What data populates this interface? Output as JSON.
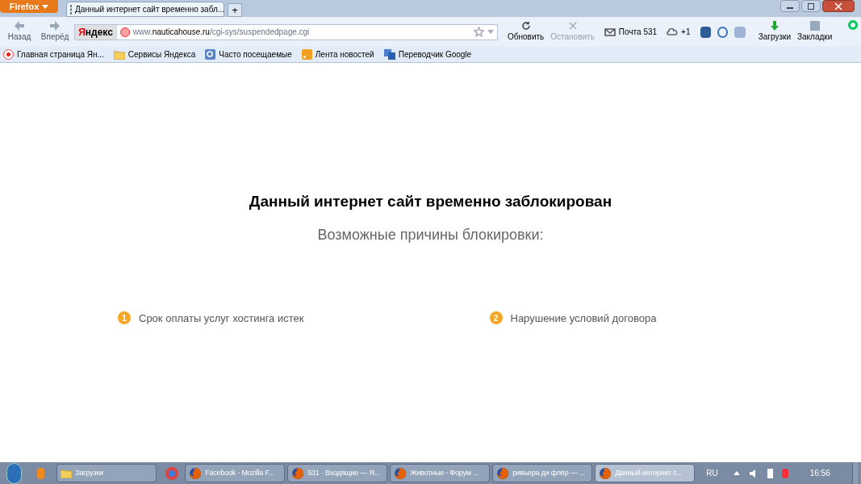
{
  "browser": {
    "menu_button": "Firefox",
    "tabs": [
      {
        "title": "Данный интернет сайт временно забл...",
        "selected": true
      }
    ],
    "new_tab": "+"
  },
  "nav": {
    "back": "Назад",
    "forward": "Вперёд",
    "search_brand": "Яндекс",
    "url_prefix": "www.",
    "url_domain": "nauticahouse.ru",
    "url_path": "/cgi-sys/suspendedpage.cgi",
    "reload": "Обновить",
    "stop": "Остановить",
    "stop_disabled": true,
    "mail": "Почта 531",
    "cloud": "+1",
    "downloads": "Загрузки",
    "bookmarks": "Закладки"
  },
  "bookmarks_bar": [
    {
      "label": "Главная страница Ян...",
      "kind": "yandex"
    },
    {
      "label": "Сервисы Яндекса",
      "kind": "folder"
    },
    {
      "label": "Часто посещаемые",
      "kind": "search"
    },
    {
      "label": "Лента новостей",
      "kind": "feed"
    },
    {
      "label": "Переводчик Google",
      "kind": "translate"
    }
  ],
  "page": {
    "heading": "Данный интернет сайт временно заблокирован",
    "subheading": "Возможные причины блокировки:",
    "reasons": [
      {
        "number": "1",
        "text": "Срок оплаты услуг хостинга истек"
      },
      {
        "number": "2",
        "text": "Нарушение условий договора"
      }
    ]
  },
  "taskbar": {
    "items": [
      {
        "label": "Загрузки",
        "kind": "folder",
        "selected": false
      },
      {
        "label": "Facebook - Mozilla F...",
        "kind": "firefox",
        "selected": false
      },
      {
        "label": "531 · Входящие — Я...",
        "kind": "firefox",
        "selected": false
      },
      {
        "label": "Животные - Форум ...",
        "kind": "firefox",
        "selected": false
      },
      {
        "label": "ривьера ди флёр — ...",
        "kind": "firefox",
        "selected": false
      },
      {
        "label": "Данный интернет с...",
        "kind": "firefox",
        "selected": true
      }
    ],
    "language": "RU",
    "clock": "16:56"
  }
}
